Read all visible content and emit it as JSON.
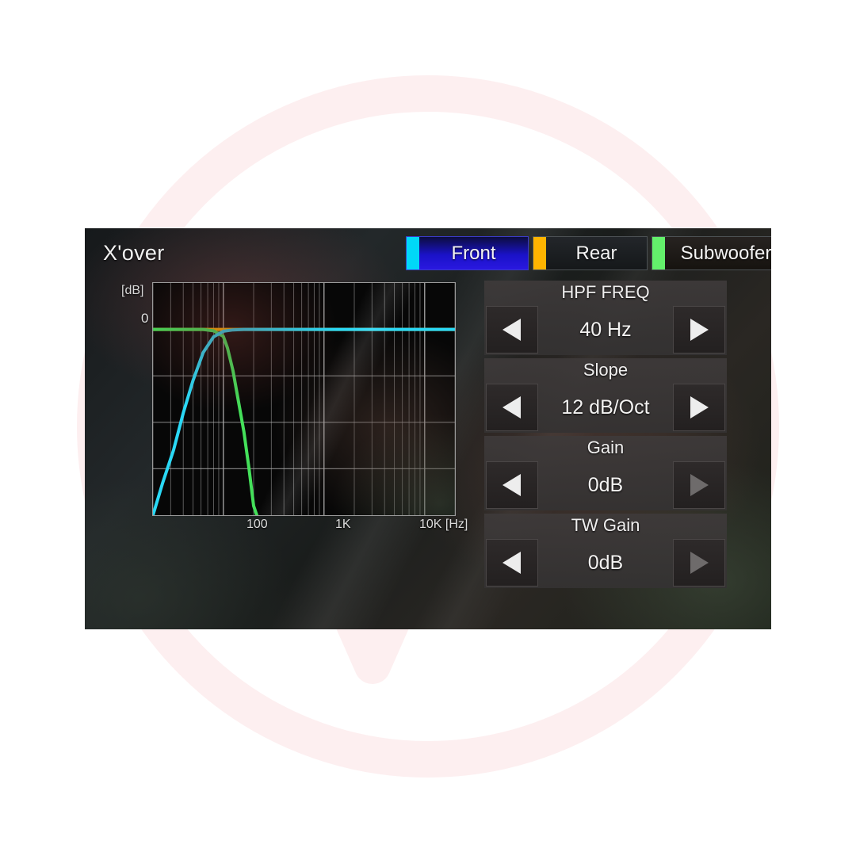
{
  "screen": {
    "title": "X'over",
    "back_icon": "back-arrow-icon"
  },
  "tabs": [
    {
      "id": "front",
      "label": "Front",
      "swatch_color": "#00d8f8",
      "selected": true
    },
    {
      "id": "rear",
      "label": "Rear",
      "swatch_color": "#ffb400",
      "selected": false
    },
    {
      "id": "subwoofer",
      "label": "Subwoofer",
      "swatch_color": "#63f06b",
      "selected": false
    }
  ],
  "controls": [
    {
      "id": "hpf-freq",
      "title": "HPF FREQ",
      "value": "40 Hz",
      "dec_icon": "left-triangle-icon",
      "inc_icon": "right-triangle-icon",
      "dec_enabled": true,
      "inc_enabled": true
    },
    {
      "id": "slope",
      "title": "Slope",
      "value": "12 dB/Oct",
      "dec_icon": "left-triangle-icon",
      "inc_icon": "right-triangle-icon",
      "dec_enabled": true,
      "inc_enabled": true
    },
    {
      "id": "gain",
      "title": "Gain",
      "value": "0dB",
      "dec_icon": "left-triangle-icon",
      "inc_icon": "right-triangle-icon",
      "dec_enabled": true,
      "inc_enabled": false
    },
    {
      "id": "tw-gain",
      "title": "TW Gain",
      "value": "0dB",
      "dec_icon": "left-triangle-icon",
      "inc_icon": "right-triangle-icon",
      "dec_enabled": true,
      "inc_enabled": false
    }
  ],
  "chart_data": {
    "type": "line",
    "title": "",
    "xlabel": "[Hz]",
    "ylabel": "[dB]",
    "xscale": "log",
    "xlim": [
      20,
      20000
    ],
    "ylim": [
      -40,
      10
    ],
    "grid": true,
    "y_ticks": [
      {
        "value": 0,
        "label": "0"
      }
    ],
    "x_ticks": [
      {
        "value": 100,
        "label": "100"
      },
      {
        "value": 1000,
        "label": "1K"
      },
      {
        "value": 10000,
        "label": "10K"
      }
    ],
    "x_unit_label": "10K [Hz]",
    "legend_position": "header-tabs",
    "series": [
      {
        "name": "Front",
        "color": "#2ad8f5",
        "description": "High-pass filter, 40 Hz, 12 dB/Oct — rises steeply from low frequency to 0 dB then flat to 20 kHz",
        "points": [
          [
            20,
            -40
          ],
          [
            25,
            -33
          ],
          [
            32,
            -26
          ],
          [
            40,
            -18
          ],
          [
            50,
            -11
          ],
          [
            63,
            -5
          ],
          [
            80,
            -1.6
          ],
          [
            100,
            -0.4
          ],
          [
            125,
            -0.1
          ],
          [
            160,
            0
          ],
          [
            250,
            0
          ],
          [
            500,
            0
          ],
          [
            1000,
            0
          ],
          [
            2000,
            0
          ],
          [
            5000,
            0
          ],
          [
            10000,
            0
          ],
          [
            20000,
            0
          ]
        ]
      },
      {
        "name": "Rear",
        "color": "#ffb400",
        "description": "Flat 0 dB response across the full band (drawn under the Front trace at 0 dB)",
        "points": [
          [
            20,
            0
          ],
          [
            100,
            0
          ],
          [
            1000,
            0
          ],
          [
            10000,
            0
          ],
          [
            20000,
            0
          ]
        ]
      },
      {
        "name": "Subwoofer",
        "color": "#44e05a",
        "description": "Low-pass filter rolling off steeply above ~100 Hz",
        "points": [
          [
            20,
            0
          ],
          [
            40,
            0
          ],
          [
            63,
            0
          ],
          [
            80,
            -0.3
          ],
          [
            100,
            -1.5
          ],
          [
            110,
            -4
          ],
          [
            125,
            -9
          ],
          [
            140,
            -15
          ],
          [
            160,
            -22
          ],
          [
            180,
            -30
          ],
          [
            200,
            -38
          ],
          [
            215,
            -40
          ]
        ]
      }
    ]
  }
}
